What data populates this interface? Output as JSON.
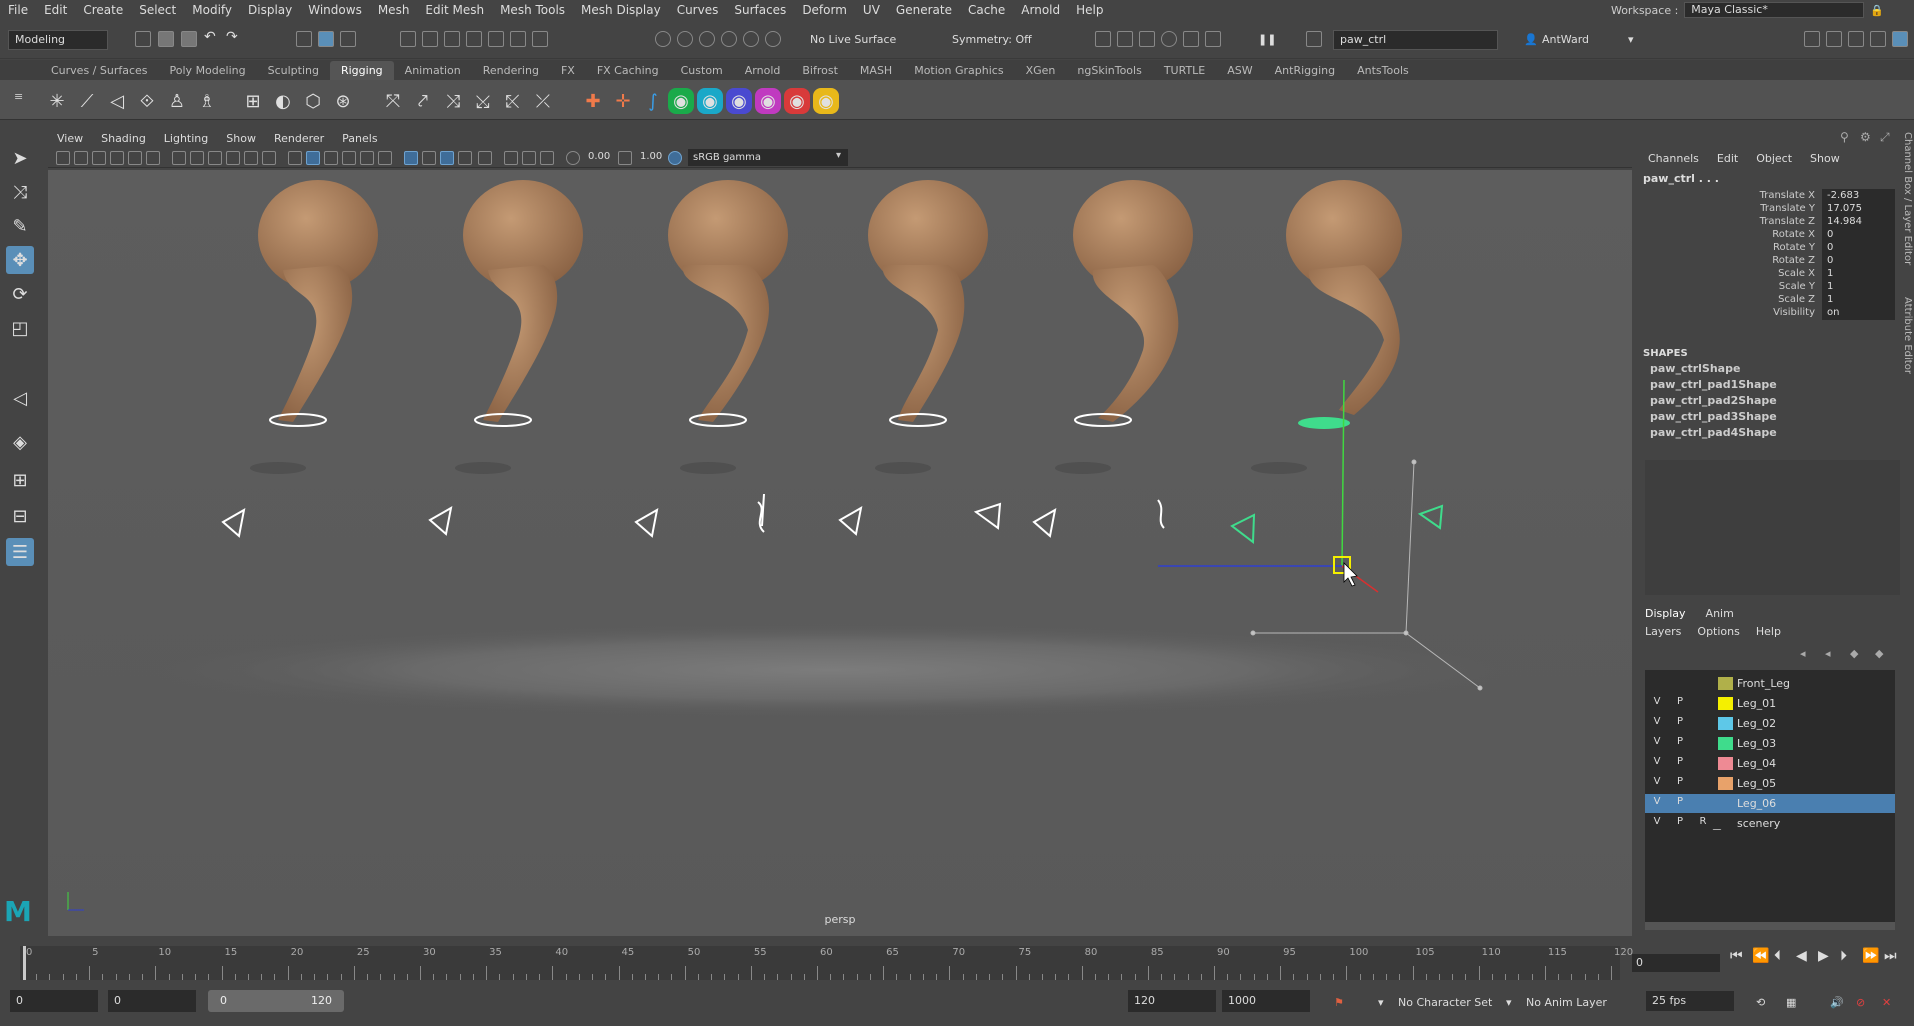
{
  "menubar": {
    "items": [
      "File",
      "Edit",
      "Create",
      "Select",
      "Modify",
      "Display",
      "Windows",
      "Mesh",
      "Edit Mesh",
      "Mesh Tools",
      "Mesh Display",
      "Curves",
      "Surfaces",
      "Deform",
      "UV",
      "Generate",
      "Cache",
      "Arnold",
      "Help"
    ],
    "workspace_label": "Workspace :",
    "workspace_value": "Maya Classic*"
  },
  "statusline": {
    "mode": "Modeling",
    "live_surface": "No Live Surface",
    "symmetry": "Symmetry: Off",
    "name_field": "paw_ctrl",
    "user": "AntWard"
  },
  "shelf_tabs": [
    "Curves / Surfaces",
    "Poly Modeling",
    "Sculpting",
    "Rigging",
    "Animation",
    "Rendering",
    "FX",
    "FX Caching",
    "Custom",
    "Arnold",
    "Bifrost",
    "MASH",
    "Motion Graphics",
    "XGen",
    "ngSkinTools",
    "TURTLE",
    "ASW",
    "AntRigging",
    "AntsTools"
  ],
  "shelf_active": "Rigging",
  "viewport": {
    "menu": [
      "View",
      "Shading",
      "Lighting",
      "Show",
      "Renderer",
      "Panels"
    ],
    "exposure": "0.00",
    "gamma": "1.00",
    "color_space": "sRGB gamma",
    "camera": "persp"
  },
  "channel_box": {
    "menu": [
      "Channels",
      "Edit",
      "Object",
      "Show"
    ],
    "object": "paw_ctrl . . .",
    "attributes": [
      {
        "label": "Translate X",
        "value": "-2.683"
      },
      {
        "label": "Translate Y",
        "value": "17.075"
      },
      {
        "label": "Translate Z",
        "value": "14.984"
      },
      {
        "label": "Rotate X",
        "value": "0"
      },
      {
        "label": "Rotate Y",
        "value": "0"
      },
      {
        "label": "Rotate Z",
        "value": "0"
      },
      {
        "label": "Scale X",
        "value": "1"
      },
      {
        "label": "Scale Y",
        "value": "1"
      },
      {
        "label": "Scale Z",
        "value": "1"
      },
      {
        "label": "Visibility",
        "value": "on"
      }
    ],
    "shapes_header": "SHAPES",
    "shapes": [
      "paw_ctrlShape",
      "paw_ctrl_pad1Shape",
      "paw_ctrl_pad2Shape",
      "paw_ctrl_pad3Shape",
      "paw_ctrl_pad4Shape"
    ]
  },
  "side_tabs": {
    "channel_box": "Channel Box / Layer Editor",
    "attribute_editor": "Attribute Editor"
  },
  "layer_editor": {
    "tabs": [
      "Display",
      "Anim"
    ],
    "menu": [
      "Layers",
      "Options",
      "Help"
    ],
    "layers": [
      {
        "v": "",
        "p": "",
        "r": "",
        "name": "Front_Leg",
        "color": "#b0b04a"
      },
      {
        "v": "V",
        "p": "P",
        "r": "",
        "name": "Leg_01",
        "color": "#f5f000"
      },
      {
        "v": "V",
        "p": "P",
        "r": "",
        "name": "Leg_02",
        "color": "#5ec8e8"
      },
      {
        "v": "V",
        "p": "P",
        "r": "",
        "name": "Leg_03",
        "color": "#3fdc8c"
      },
      {
        "v": "V",
        "p": "P",
        "r": "",
        "name": "Leg_04",
        "color": "#ee8a94"
      },
      {
        "v": "V",
        "p": "P",
        "r": "",
        "name": "Leg_05",
        "color": "#e8a26a"
      },
      {
        "v": "V",
        "p": "P",
        "r": "",
        "name": "Leg_06",
        "color": "#4a7fb0"
      },
      {
        "v": "V",
        "p": "P",
        "r": "R",
        "name": "scenery",
        "color": ""
      }
    ]
  },
  "time_slider": {
    "ticks": [
      "0",
      "5",
      "10",
      "15",
      "20",
      "25",
      "30",
      "35",
      "40",
      "45",
      "50",
      "55",
      "60",
      "65",
      "70",
      "75",
      "80",
      "85",
      "90",
      "95",
      "100",
      "105",
      "110",
      "115",
      "120"
    ],
    "current": "0"
  },
  "range_slider": {
    "start": "0",
    "playback_start": "0",
    "range_start": "0",
    "range_end": "120",
    "playback_end": "120",
    "end": "1000",
    "character_set": "No Character Set",
    "anim_layer": "No Anim Layer",
    "fps": "25 fps"
  },
  "logo": "M"
}
